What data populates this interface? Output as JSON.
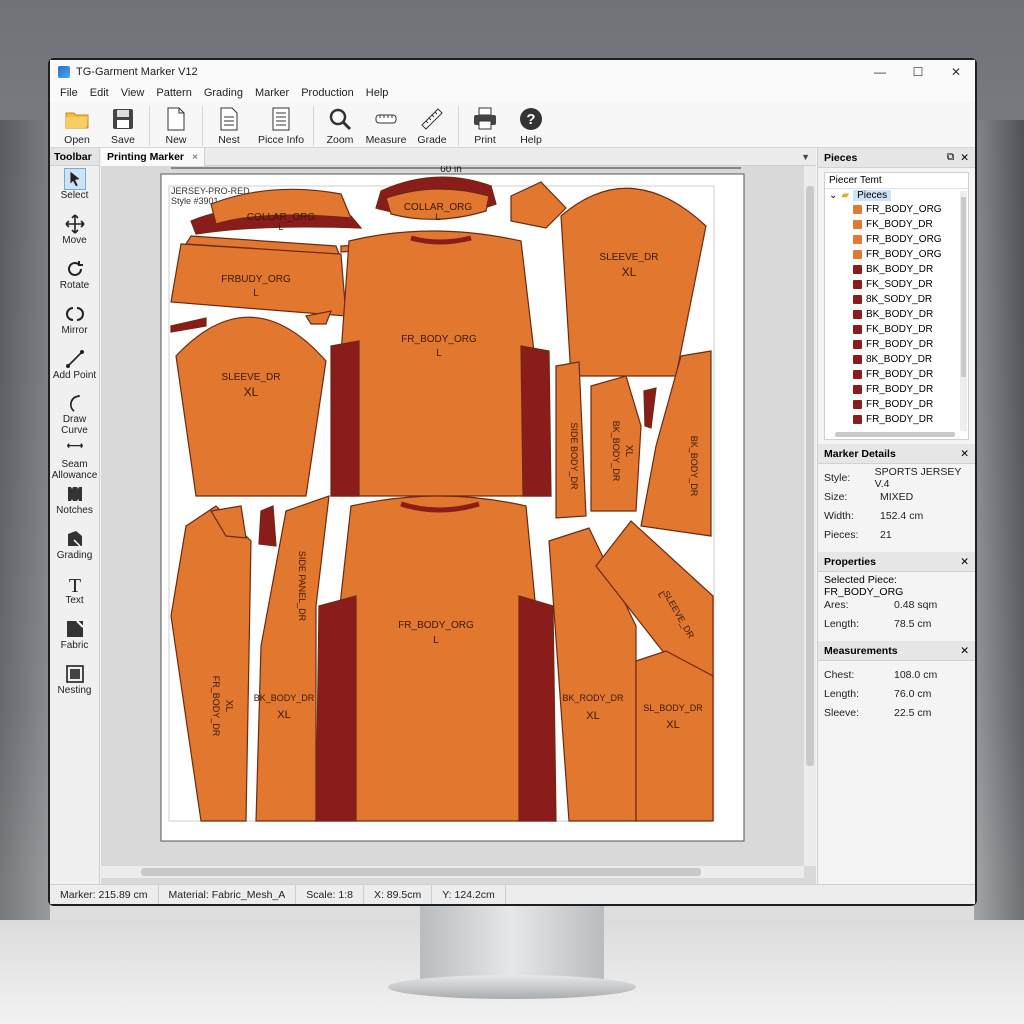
{
  "window": {
    "title": "TG-Garment Marker V12",
    "minimize": "—",
    "maximize": "☐",
    "close": "✕"
  },
  "menu": [
    "File",
    "Edit",
    "View",
    "Pattern",
    "Grading",
    "Marker",
    "Production",
    "Help"
  ],
  "ribbon": {
    "open": "Open",
    "save": "Save",
    "new": "New",
    "nest": "Nest",
    "piece_info": "Picce Info",
    "zoom": "Zoom",
    "measure": "Measure",
    "grade": "Grade",
    "print": "Print",
    "help": "Help"
  },
  "left_panel": {
    "header": "Toolbar",
    "tools": [
      "Select",
      "Move",
      "Rotate",
      "Mirror",
      "Add Point",
      "Draw Curve",
      "Seam Allowance",
      "Notches",
      "Grading",
      "Text",
      "Fabric",
      "Nesting"
    ]
  },
  "document": {
    "tab": "Printing Marker",
    "tab_close": "×",
    "width_label": "60 in",
    "style_line1": "JERSEY-PRO-RED",
    "style_line2": "Style #3901",
    "pieces": {
      "collar_left": "COLLAR_ORG",
      "collar_left_size": "L",
      "collar_center": "COLLAR_ORG",
      "collar_center_size": "L",
      "frbody_small": "FRBUDY_ORG",
      "frbody_small_size": "L",
      "sleeve_top_right": "SLEEVE_DR",
      "sleeve_top_right_size": "XL",
      "front_top": "FR_BODY_ORG",
      "front_top_size": "L",
      "sleeve_left": "SLEEVE_DR",
      "sleeve_left_size": "XL",
      "side_strip_a": "SIDE BODY_DR",
      "side_panel_b": "BK_BODY_DR",
      "side_panel_b_size": "XL",
      "side_panel_c": "BK_BODY_DR",
      "front_bottom": "FR_BODY_ORG",
      "front_bottom_size": "L",
      "left_long_a": "FR_BODY_DR",
      "left_long_a_size": "XL",
      "left_long_b": "BK_BODY_DR",
      "left_long_b_size": "XL",
      "left_strip": "SIDE PANEL_DR",
      "back_right": "BK_RODY_DR",
      "back_right_size": "XL",
      "diag_piece": "SLEEVE_DR",
      "diag_size": "L",
      "side_right": "SL_BODY_DR",
      "side_right_size": "XL"
    }
  },
  "pieces_panel": {
    "header": "Pieces",
    "tree_header": "Piecer Temt",
    "root": "Pieces",
    "items": [
      {
        "label": "FR_BODY_ORG",
        "color": "#e07a32"
      },
      {
        "label": "FK_BODY_DR",
        "color": "#e07a32"
      },
      {
        "label": "FR_BODY_ORG",
        "color": "#e07a32"
      },
      {
        "label": "FR_BODY_ORG",
        "color": "#e07a32"
      },
      {
        "label": "BK_BODY_DR",
        "color": "#8b1c1c"
      },
      {
        "label": "FK_SODY_DR",
        "color": "#8b1c1c"
      },
      {
        "label": "8K_SODY_DR",
        "color": "#8b1c1c"
      },
      {
        "label": "BK_BODY_DR",
        "color": "#8b1c1c"
      },
      {
        "label": "FK_BODY_DR",
        "color": "#8b1c1c"
      },
      {
        "label": "FR_BODY_DR",
        "color": "#8b1c1c"
      },
      {
        "label": "8K_BODY_DR",
        "color": "#8b1c1c"
      },
      {
        "label": "FR_BODY_DR",
        "color": "#8b1c1c"
      },
      {
        "label": "FR_BODY_DR",
        "color": "#8b1c1c"
      },
      {
        "label": "FR_BODY_DR",
        "color": "#8b1c1c"
      },
      {
        "label": "FR_BODY_DR",
        "color": "#8b1c1c"
      }
    ]
  },
  "marker_details": {
    "header": "Marker Details",
    "style_k": "Style:",
    "style_v": "SPORTS JERSEY V.4",
    "size_k": "Size:",
    "size_v": "MIXED",
    "width_k": "Width:",
    "width_v": "152.4 cm",
    "pieces_k": "Pieces:",
    "pieces_v": "21"
  },
  "properties": {
    "header": "Properties",
    "selected": "Selected Piece: FR_BODY_ORG",
    "area_k": "Ares:",
    "area_v": "0.48 sqm",
    "length_k": "Length:",
    "length_v": "78.5 cm"
  },
  "measurements": {
    "header": "Measurements",
    "chest_k": "Chest:",
    "chest_v": "108.0 cm",
    "length_k": "Length:",
    "length_v": "76.0 cm",
    "sleeve_k": "Sleeve:",
    "sleeve_v": "22.5 cm"
  },
  "status": {
    "marker": "Marker: 215.89 cm",
    "material": "Material: Fabric_Mesh_A",
    "scale": "Scale: 1:8",
    "x": "X: 89.5cm",
    "y": "Y: 124.2cm"
  },
  "colors": {
    "orange": "#e2772f",
    "dark_red": "#8b1c1c",
    "accent": "#1e6fc9"
  }
}
